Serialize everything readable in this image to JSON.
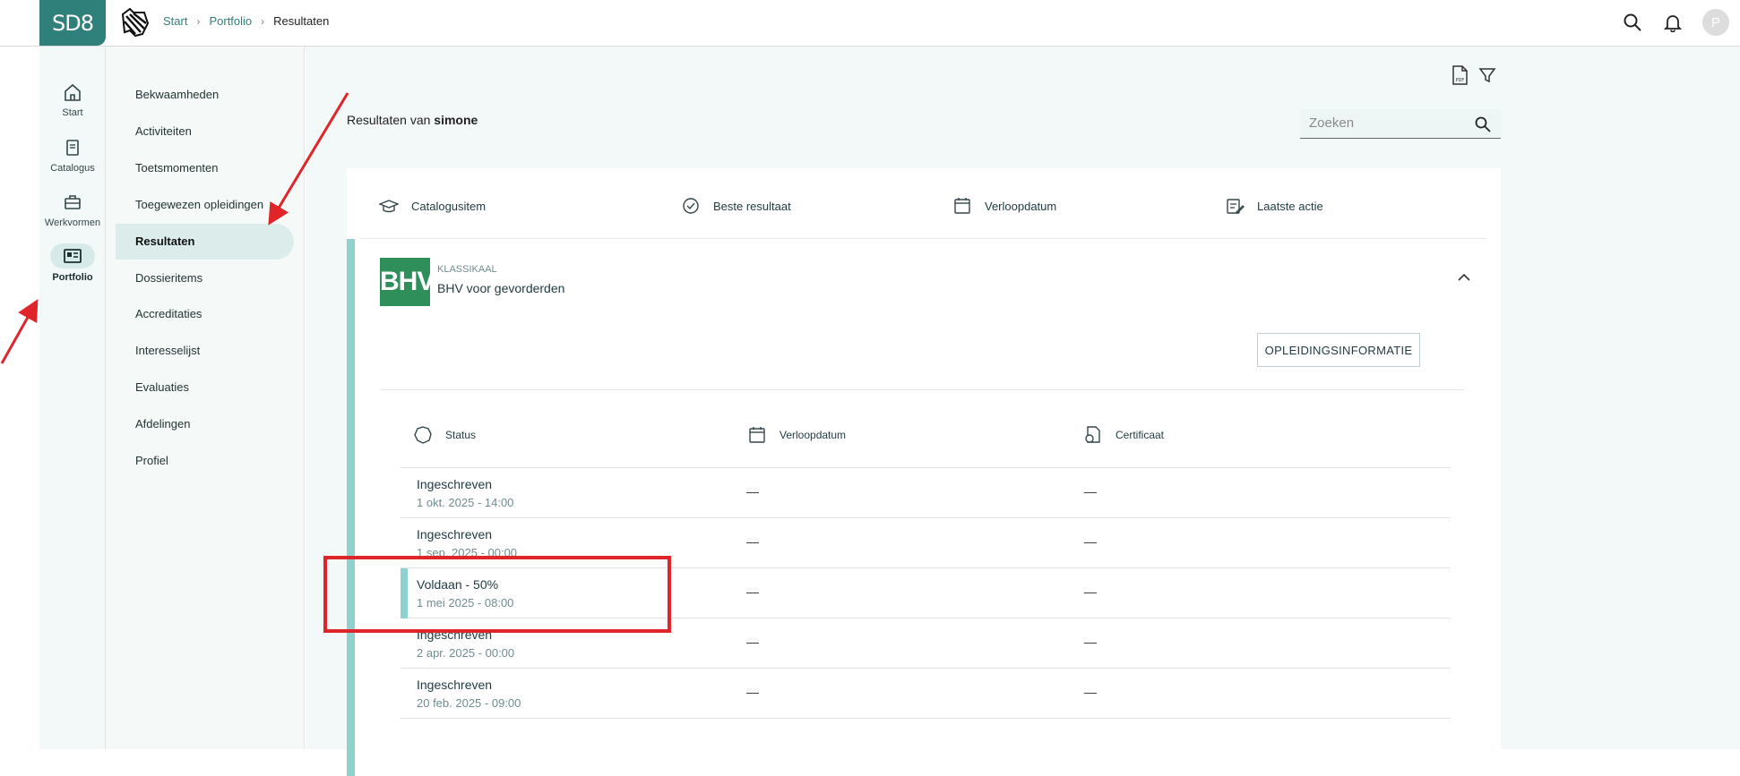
{
  "app": {
    "logo_text": "SD8"
  },
  "breadcrumb": {
    "items": [
      "Start",
      "Portfolio",
      "Resultaten"
    ],
    "separator": "›"
  },
  "topbar": {
    "avatar_letter": "P"
  },
  "rail": {
    "items": [
      {
        "label": "Start",
        "icon": "home-icon"
      },
      {
        "label": "Catalogus",
        "icon": "book-icon"
      },
      {
        "label": "Werkvormen",
        "icon": "briefcase-icon"
      },
      {
        "label": "Portfolio",
        "icon": "id-card-icon",
        "active": true
      }
    ]
  },
  "submenu": {
    "items": [
      "Bekwaamheden",
      "Activiteiten",
      "Toetsmomenten",
      "Toegewezen opleidingen",
      "Resultaten",
      "Dossieritems",
      "Accreditaties",
      "Interesselijst",
      "Evaluaties",
      "Afdelingen",
      "Profiel"
    ],
    "active": "Resultaten"
  },
  "main": {
    "title_prefix": "Resultaten van",
    "title_user": "simone",
    "search_placeholder": "Zoeken",
    "columns": [
      "Catalogusitem",
      "Beste resultaat",
      "Verloopdatum",
      "Laatste actie"
    ],
    "course": {
      "thumb_text": "BHV",
      "type": "KLASSIKAAL",
      "name": "BHV voor gevorderden",
      "info_button": "OPLEIDINGSINFORMATIE"
    },
    "result_columns": [
      "Status",
      "Verloopdatum",
      "Certificaat"
    ],
    "results": [
      {
        "status": "Ingeschreven",
        "date": "1 okt. 2025 - 14:00",
        "expiry": "—",
        "certificate": "—"
      },
      {
        "status": "Ingeschreven",
        "date": "1 sep. 2025 - 00:00",
        "expiry": "—",
        "certificate": "—"
      },
      {
        "status": "Voldaan - 50%",
        "date": "1 mei 2025 - 08:00",
        "expiry": "—",
        "certificate": "—",
        "highlighted": true
      },
      {
        "status": "Ingeschreven",
        "date": "2 apr. 2025 - 00:00",
        "expiry": "—",
        "certificate": "—"
      },
      {
        "status": "Ingeschreven",
        "date": "20 feb. 2025 - 09:00",
        "expiry": "—",
        "certificate": "—"
      }
    ]
  },
  "colors": {
    "brand": "#2f7f7a",
    "accent": "#8fd1cf",
    "annotation": "#e0252a",
    "thumb": "#2e8f5b"
  }
}
